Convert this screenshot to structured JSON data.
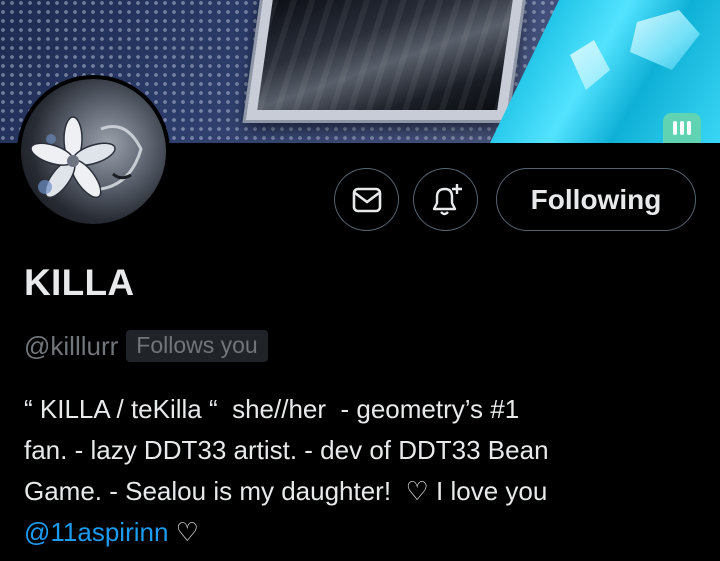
{
  "profile": {
    "name": "KILLA",
    "handle": "@killlurr",
    "follows_you_label": "Follows you"
  },
  "actions": {
    "message_icon": "envelope-icon",
    "notify_icon": "bell-plus-icon",
    "following_label": "Following"
  },
  "bio": {
    "line1": "“ KILLA / teKilla “  she//her  - geometry’s #1",
    "line2": "fan. - lazy DDT33 artist. - dev of DDT33 Bean",
    "line3": "Game. - Sealou is my daughter!  ♡ I love you",
    "mention": "@11aspirinn",
    "line4_suffix": " ♡"
  },
  "colors": {
    "background": "#000000",
    "text_primary": "#e7e9ea",
    "text_secondary": "#71767b",
    "link": "#1d9bf0",
    "border": "#536471"
  }
}
